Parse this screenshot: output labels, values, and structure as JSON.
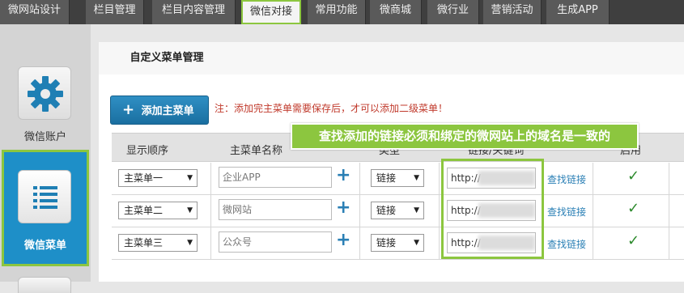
{
  "topnav": {
    "tabs": [
      {
        "label": "微网站设计"
      },
      {
        "label": "栏目管理"
      },
      {
        "label": "栏目内容管理"
      },
      {
        "label": "微信对接"
      },
      {
        "label": "常用功能"
      },
      {
        "label": "微商城"
      },
      {
        "label": "微行业"
      },
      {
        "label": "营销活动"
      },
      {
        "label": "生成APP"
      }
    ],
    "active_index": 3
  },
  "sidebar": {
    "items": [
      {
        "label": "微信账户",
        "icon": "gear-icon"
      },
      {
        "label": "微信菜单",
        "icon": "menu-list-icon"
      }
    ]
  },
  "panel": {
    "tab_title": "自定义菜单管理",
    "add_button": "添加主菜单",
    "note": "注：添加完主菜单需要保存后，才可以添加二级菜单！"
  },
  "table": {
    "headers": [
      "显示顺序",
      "主菜单名称",
      "类型",
      "链接/关键词",
      "启用"
    ],
    "rows": [
      {
        "order": "主菜单一",
        "name": "企业APP",
        "type": "链接",
        "link": "http://",
        "find": "查找链接",
        "enabled": "✓"
      },
      {
        "order": "主菜单二",
        "name": "微网站",
        "type": "链接",
        "link": "http://",
        "find": "查找链接",
        "enabled": "✓"
      },
      {
        "order": "主菜单三",
        "name": "公众号",
        "type": "链接",
        "link": "http://",
        "find": "查找链接",
        "enabled": "✓"
      }
    ]
  },
  "callout": {
    "text": "查找添加的链接必须和绑定的微网站上的域名是一致的"
  },
  "colors": {
    "highlight": "#8cc63f",
    "active_blue": "#1e8fc8",
    "link_blue": "#2a7fb5",
    "note_red": "#c0392b"
  }
}
